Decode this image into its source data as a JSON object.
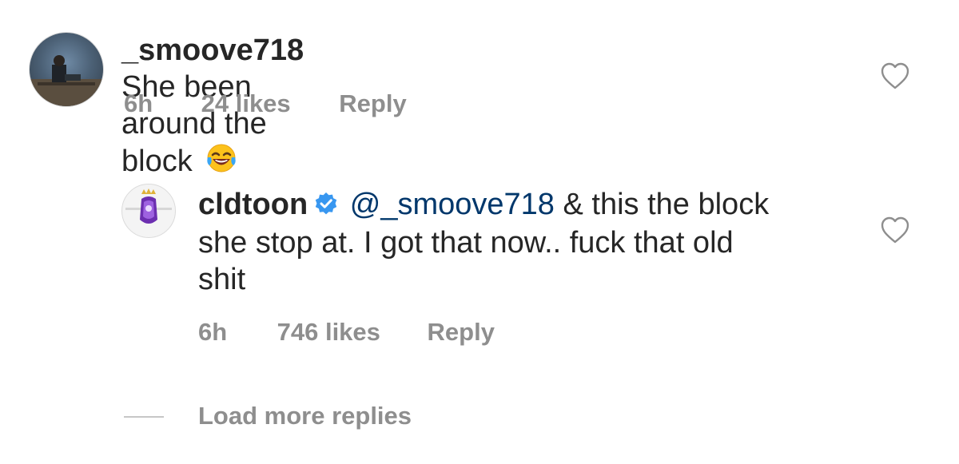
{
  "comments": [
    {
      "username": "_smoove718",
      "text": "She been around the block",
      "emoji": "face-with-tears-of-joy",
      "time": "6h",
      "likes": "24 likes",
      "reply_label": "Reply"
    },
    {
      "username": "cldtoon",
      "verified": true,
      "mention": "@_smoove718",
      "text_line1": "& this the block",
      "text_line2": "she stop at. I got that now.. fuck that old",
      "text_line3": "shit",
      "time": "6h",
      "likes": "746 likes",
      "reply_label": "Reply"
    }
  ],
  "load_more_label": "Load more replies",
  "colors": {
    "text": "#262626",
    "meta": "#8e8e8e",
    "mention": "#00376b",
    "verified": "#3897f0"
  }
}
